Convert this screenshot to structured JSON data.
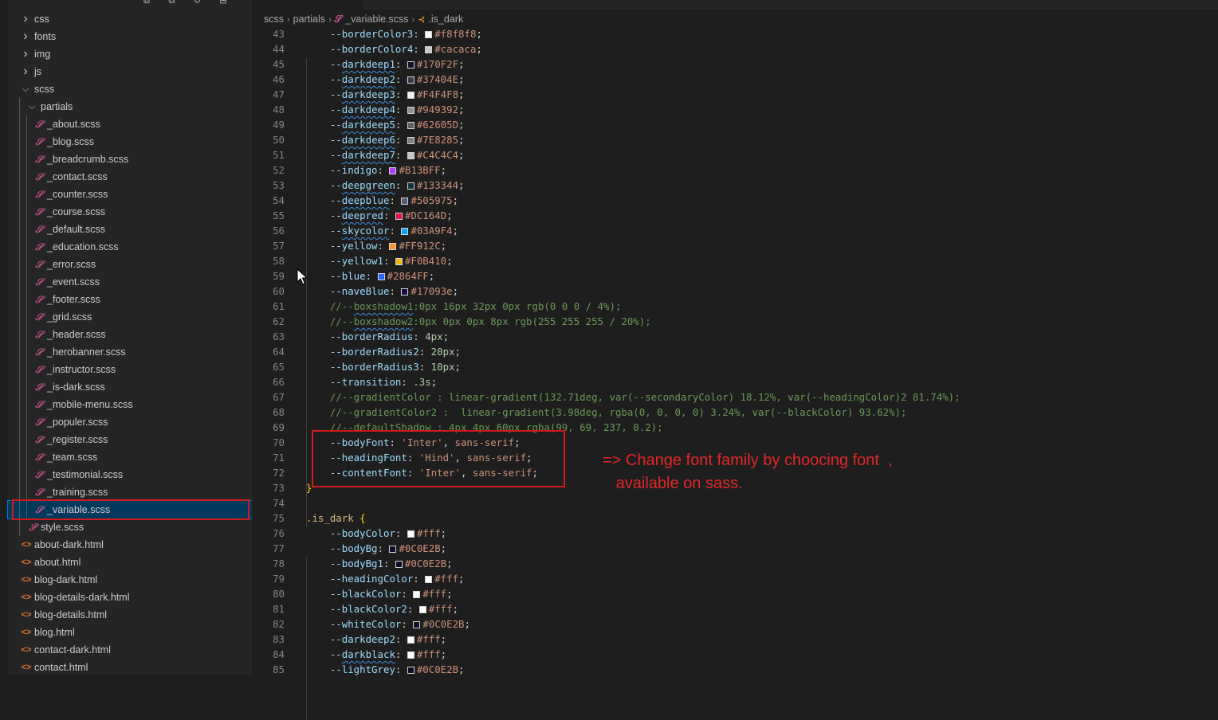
{
  "explorer": {
    "top_icons": "⧉ ⧉ ↻ ⊟",
    "items": [
      {
        "label": "css",
        "kind": "folder",
        "open": false,
        "depth": 1
      },
      {
        "label": "fonts",
        "kind": "folder",
        "open": false,
        "depth": 1
      },
      {
        "label": "img",
        "kind": "folder",
        "open": false,
        "depth": 1
      },
      {
        "label": "js",
        "kind": "folder",
        "open": false,
        "depth": 1
      },
      {
        "label": "scss",
        "kind": "folder",
        "open": true,
        "depth": 1
      },
      {
        "label": "partials",
        "kind": "folder",
        "open": true,
        "depth": 2
      },
      {
        "label": "_about.scss",
        "kind": "scss",
        "depth": 3
      },
      {
        "label": "_blog.scss",
        "kind": "scss",
        "depth": 3
      },
      {
        "label": "_breadcrumb.scss",
        "kind": "scss",
        "depth": 3
      },
      {
        "label": "_contact.scss",
        "kind": "scss",
        "depth": 3
      },
      {
        "label": "_counter.scss",
        "kind": "scss",
        "depth": 3
      },
      {
        "label": "_course.scss",
        "kind": "scss",
        "depth": 3
      },
      {
        "label": "_default.scss",
        "kind": "scss",
        "depth": 3
      },
      {
        "label": "_education.scss",
        "kind": "scss",
        "depth": 3
      },
      {
        "label": "_error.scss",
        "kind": "scss",
        "depth": 3
      },
      {
        "label": "_event.scss",
        "kind": "scss",
        "depth": 3
      },
      {
        "label": "_footer.scss",
        "kind": "scss",
        "depth": 3
      },
      {
        "label": "_grid.scss",
        "kind": "scss",
        "depth": 3
      },
      {
        "label": "_header.scss",
        "kind": "scss",
        "depth": 3
      },
      {
        "label": "_herobanner.scss",
        "kind": "scss",
        "depth": 3
      },
      {
        "label": "_instructor.scss",
        "kind": "scss",
        "depth": 3
      },
      {
        "label": "_is-dark.scss",
        "kind": "scss",
        "depth": 3
      },
      {
        "label": "_mobile-menu.scss",
        "kind": "scss",
        "depth": 3
      },
      {
        "label": "_populer.scss",
        "kind": "scss",
        "depth": 3
      },
      {
        "label": "_register.scss",
        "kind": "scss",
        "depth": 3
      },
      {
        "label": "_team.scss",
        "kind": "scss",
        "depth": 3
      },
      {
        "label": "_testimonial.scss",
        "kind": "scss",
        "depth": 3
      },
      {
        "label": "_training.scss",
        "kind": "scss",
        "depth": 3
      },
      {
        "label": "_variable.scss",
        "kind": "scss",
        "depth": 3,
        "selected": true
      },
      {
        "label": "style.scss",
        "kind": "scss",
        "depth": 2
      },
      {
        "label": "about-dark.html",
        "kind": "html",
        "depth": 1
      },
      {
        "label": "about.html",
        "kind": "html",
        "depth": 1
      },
      {
        "label": "blog-dark.html",
        "kind": "html",
        "depth": 1
      },
      {
        "label": "blog-details-dark.html",
        "kind": "html",
        "depth": 1
      },
      {
        "label": "blog-details.html",
        "kind": "html",
        "depth": 1
      },
      {
        "label": "blog.html",
        "kind": "html",
        "depth": 1
      },
      {
        "label": "contact-dark.html",
        "kind": "html",
        "depth": 1
      },
      {
        "label": "contact.html",
        "kind": "html",
        "depth": 1
      }
    ]
  },
  "breadcrumb": {
    "parts": [
      "scss",
      "partials",
      "_variable.scss",
      ".is_dark"
    ]
  },
  "colors": {
    "sass": "#c6538c",
    "html": "#e37933",
    "annotation": "#e2262b",
    "selection": "#04395e"
  },
  "code_lines": [
    {
      "n": "43",
      "t": "decl",
      "prop": "--borderColor3",
      "val": "#f8f8f8",
      "swatch": "#f8f8f8"
    },
    {
      "n": "44",
      "t": "decl",
      "prop": "--borderColor4",
      "val": "#cacaca",
      "swatch": "#cacaca"
    },
    {
      "n": "45",
      "t": "decl",
      "prop": "--darkdeep1",
      "val": "#170F2F",
      "swatch": "#170F2F",
      "u": true
    },
    {
      "n": "46",
      "t": "decl",
      "prop": "--darkdeep2",
      "val": "#37404E",
      "swatch": "#37404E",
      "u": true
    },
    {
      "n": "47",
      "t": "decl",
      "prop": "--darkdeep3",
      "val": "#F4F4F8",
      "swatch": "#F4F4F8",
      "u": true
    },
    {
      "n": "48",
      "t": "decl",
      "prop": "--darkdeep4",
      "val": "#949392",
      "swatch": "#949392",
      "u": true
    },
    {
      "n": "49",
      "t": "decl",
      "prop": "--darkdeep5",
      "val": "#62605D",
      "swatch": "#62605D",
      "u": true
    },
    {
      "n": "50",
      "t": "decl",
      "prop": "--darkdeep6",
      "val": "#7E8285",
      "swatch": "#7E8285",
      "u": true
    },
    {
      "n": "51",
      "t": "decl",
      "prop": "--darkdeep7",
      "val": "#C4C4C4",
      "swatch": "#C4C4C4",
      "u": true
    },
    {
      "n": "52",
      "t": "decl",
      "prop": "--indigo",
      "val": "#B13BFF",
      "swatch": "#B13BFF"
    },
    {
      "n": "53",
      "t": "decl",
      "prop": "--deepgreen",
      "val": "#133344",
      "swatch": "#133344",
      "u": true
    },
    {
      "n": "54",
      "t": "decl",
      "prop": "--deepblue",
      "val": "#505975",
      "swatch": "#505975",
      "u": true
    },
    {
      "n": "55",
      "t": "decl",
      "prop": "--deepred",
      "val": "#DC164D",
      "swatch": "#DC164D",
      "u": true
    },
    {
      "n": "56",
      "t": "decl",
      "prop": "--skycolor",
      "val": "#03A9F4",
      "swatch": "#03A9F4",
      "u": true
    },
    {
      "n": "57",
      "t": "decl",
      "prop": "--yellow",
      "val": "#FF912C",
      "swatch": "#FF912C"
    },
    {
      "n": "58",
      "t": "decl",
      "prop": "--yellow1",
      "val": "#F0B410",
      "swatch": "#F0B410"
    },
    {
      "n": "59",
      "t": "decl",
      "prop": "--blue",
      "val": "#2864FF",
      "swatch": "#2864FF"
    },
    {
      "n": "60",
      "t": "decl",
      "prop": "--naveBlue",
      "val": "#17093e",
      "swatch": "#17093e"
    },
    {
      "n": "61",
      "t": "comment",
      "pre": "//--",
      "under": "boxshadow1",
      "post": ":0px 16px 32px 0px rgb(0 0 0 / 4%);"
    },
    {
      "n": "62",
      "t": "comment",
      "pre": "//--",
      "under": "boxshadow2",
      "post": ":0px 0px 0px 8px rgb(255 255 255 / 20%);"
    },
    {
      "n": "63",
      "t": "decl",
      "prop": "--borderRadius",
      "val": "4px",
      "num": true
    },
    {
      "n": "64",
      "t": "decl",
      "prop": "--borderRadius2",
      "val": "20px",
      "num": true
    },
    {
      "n": "65",
      "t": "decl",
      "prop": "--borderRadius3",
      "val": "10px",
      "num": true
    },
    {
      "n": "66",
      "t": "decl",
      "prop": "--transition",
      "val": ".3s",
      "num": true
    },
    {
      "n": "67",
      "t": "comment",
      "pre": "//--gradientColor : linear-gradient(132.71deg, var(--secondaryColor) 18.12%, var(--headingColor)2 81.74%);"
    },
    {
      "n": "68",
      "t": "comment",
      "pre": "//--gradientColor2 :  linear-gradient(3.98deg, rgba(0, 0, 0, 0) 3.24%, var(--blackColor) 93.62%);"
    },
    {
      "n": "69",
      "t": "comment",
      "pre": "//--defaultShadow : 4px 4px 60px rgba(99, 69, 237, 0.2);"
    },
    {
      "n": "70",
      "t": "font",
      "prop": "--bodyFont",
      "font": "'Inter'"
    },
    {
      "n": "71",
      "t": "font",
      "prop": "--headingFont",
      "font": "'Hind'"
    },
    {
      "n": "72",
      "t": "font",
      "prop": "--contentFont",
      "font": "'Inter'"
    },
    {
      "n": "73",
      "t": "close",
      "text": "}"
    },
    {
      "n": "74",
      "t": "empty"
    },
    {
      "n": "75",
      "t": "selector",
      "text": ".is_dark"
    },
    {
      "n": "76",
      "t": "decl",
      "prop": "--bodyColor",
      "val": "#fff",
      "swatch": "#ffffff"
    },
    {
      "n": "77",
      "t": "decl",
      "prop": "--bodyBg",
      "val": "#0C0E2B",
      "swatch": "#0C0E2B"
    },
    {
      "n": "78",
      "t": "decl",
      "prop": "--bodyBg1",
      "val": "#0C0E2B",
      "swatch": "#0C0E2B"
    },
    {
      "n": "79",
      "t": "decl",
      "prop": "--headingColor",
      "val": "#fff",
      "swatch": "#ffffff"
    },
    {
      "n": "80",
      "t": "decl",
      "prop": "--blackColor",
      "val": "#fff",
      "swatch": "#ffffff"
    },
    {
      "n": "81",
      "t": "decl",
      "prop": "--blackColor2",
      "val": "#fff",
      "swatch": "#ffffff"
    },
    {
      "n": "82",
      "t": "decl",
      "prop": "--whiteColor",
      "val": "#0C0E2B",
      "swatch": "#0C0E2B"
    },
    {
      "n": "83",
      "t": "decl",
      "prop": "--darkdeep2",
      "val": "#fff",
      "swatch": "#ffffff"
    },
    {
      "n": "84",
      "t": "decl",
      "prop": "--darkblack",
      "val": "#fff",
      "swatch": "#ffffff",
      "u": true
    },
    {
      "n": "85",
      "t": "decl",
      "prop": "--lightGrey",
      "val": "#0C0E2B",
      "swatch": "#0C0E2B"
    }
  ],
  "sans_serif_kw": "sans-serif",
  "annotation": {
    "line1": "=> Change font family by choocing font  ,",
    "line2": "   available on sass."
  }
}
